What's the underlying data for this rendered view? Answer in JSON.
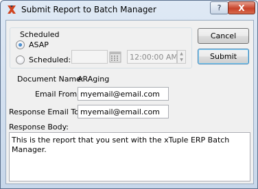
{
  "window": {
    "title": "Submit Report to Batch Manager",
    "help_label": "?",
    "close_label": "X"
  },
  "scheduled": {
    "group_label": "Scheduled",
    "asap_label": "ASAP",
    "scheduled_label": "Scheduled:",
    "date_value": "",
    "time_value": "12:00:00 AM",
    "asap_selected": true
  },
  "buttons": {
    "cancel": "Cancel",
    "submit": "Submit"
  },
  "document": {
    "name_label": "Document Name:",
    "name_value": "ARAging"
  },
  "email": {
    "from_label": "Email From:",
    "from_value": "myemail@email.com",
    "response_label": "Response Email To:",
    "response_value": "myemail@email.com"
  },
  "response_body": {
    "label": "Response Body:",
    "value": "This is the report that you sent with the xTuple ERP Batch Manager."
  }
}
